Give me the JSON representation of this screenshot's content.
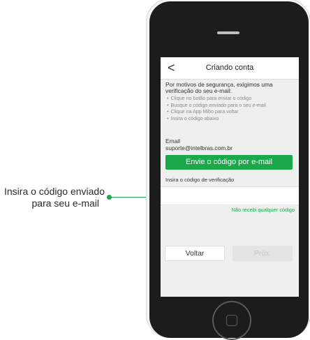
{
  "callout": {
    "line1": "Insira o código enviado",
    "line2": "para seu e-mail"
  },
  "colors": {
    "accent": "#1aa84a",
    "phone_body": "#1c1c1c",
    "screen_bg": "#efefef"
  },
  "header": {
    "back_icon": "chevron-left-icon",
    "back_glyph": "<",
    "title": "Criando conta"
  },
  "intro": "Por motivos de segurança, exigimos uma verificação do seu e-mail:",
  "steps": [
    "Clique no botão para enviar o código",
    "Busque o código enviado para o seu e-mail",
    "Clique na App Mibo para voltar",
    "Insira o código abaixo"
  ],
  "email": {
    "label": "Email",
    "value": "suporte@intelbras.com.br"
  },
  "send_button": "Envie o código por e-mail",
  "code": {
    "label": "Insira o código de verificação",
    "value": ""
  },
  "resend_link": "Não recebi qualquer código",
  "footer": {
    "back_button": "Voltar",
    "next_button": "Próx."
  }
}
